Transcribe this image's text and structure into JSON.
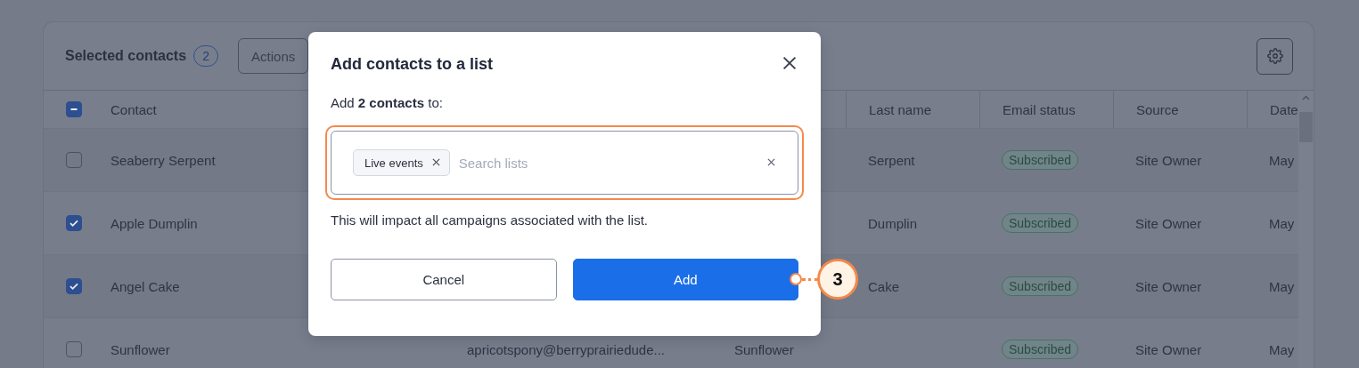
{
  "toolbar": {
    "title": "Selected contacts",
    "count": "2",
    "actions": "Actions"
  },
  "table": {
    "select_all": {
      "indeterminate": true
    },
    "columns": {
      "contact": "Contact",
      "last_name": "Last name",
      "email_status": "Email status",
      "source": "Source",
      "date": "Date"
    },
    "rows": [
      {
        "checked": false,
        "contact": "Seaberry Serpent",
        "last_name": "Serpent",
        "email_status": "Subscribed",
        "source": "Site Owner",
        "date": "May"
      },
      {
        "checked": true,
        "contact": "Apple Dumplin",
        "last_name": "Dumplin",
        "email_status": "Subscribed",
        "source": "Site Owner",
        "date": "May"
      },
      {
        "checked": true,
        "contact": "Angel Cake",
        "last_name": "Cake",
        "email_status": "Subscribed",
        "source": "Site Owner",
        "date": "May"
      },
      {
        "checked": false,
        "contact": "Sunflower",
        "email": "apricotspony@berryprairiedude...",
        "first_name": "Sunflower",
        "email_status": "Subscribed",
        "source": "Site Owner",
        "date": "May"
      }
    ]
  },
  "dialog": {
    "title": "Add contacts to a list",
    "intro": "Add **2 contacts** to:",
    "chips": [
      "Live events"
    ],
    "placeholder": "Search lists",
    "note": "This will impact all campaigns associated with the list.",
    "cancel": "Cancel",
    "confirm": "Add"
  },
  "annotation": {
    "number": "3"
  }
}
